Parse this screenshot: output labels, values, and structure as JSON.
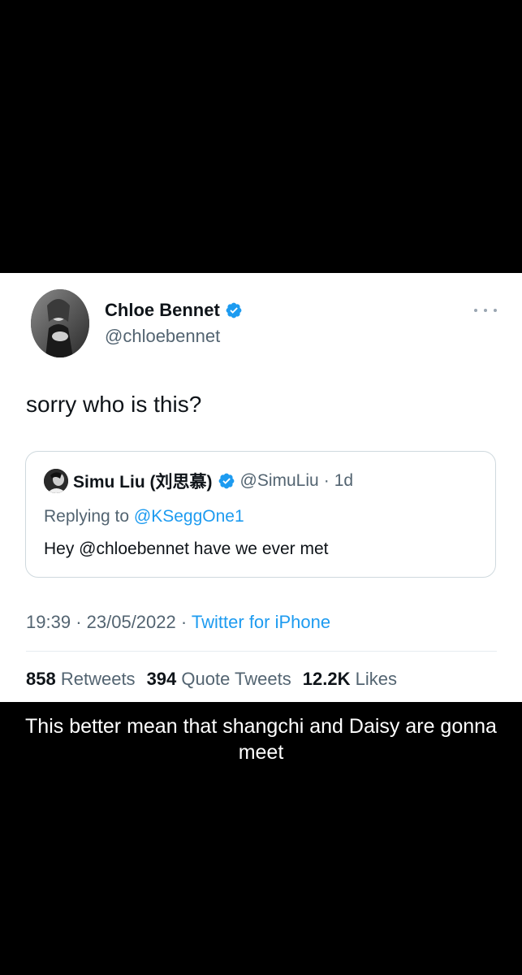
{
  "tweet": {
    "display_name": "Chloe Bennet",
    "handle": "@chloebennet",
    "text": "sorry who is this?",
    "time": "19:39",
    "date": "23/05/2022",
    "source": "Twitter for iPhone",
    "separator": "·"
  },
  "quoted_tweet": {
    "display_name": "Simu Liu (刘思慕)",
    "handle": "@SimuLiu",
    "age": "1d",
    "replying_prefix": "Replying to",
    "replying_to": "@KSeggOne1",
    "text": "Hey @chloebennet have we ever met"
  },
  "stats": {
    "retweets_count": "858",
    "retweets_label": "Retweets",
    "quote_tweets_count": "394",
    "quote_tweets_label": "Quote Tweets",
    "likes_count": "12.2K",
    "likes_label": "Likes"
  },
  "caption": {
    "text": "This better mean that shangchi and Daisy are gonna meet"
  },
  "icons": {
    "verified": "verified-badge-icon",
    "more": "more-options-icon"
  },
  "colors": {
    "link_blue": "#1d9bf0",
    "verified_blue": "#1d9bf0",
    "text_primary": "#0f1419",
    "text_secondary": "#536471",
    "background_outer": "#000000",
    "card_background": "#ffffff"
  }
}
